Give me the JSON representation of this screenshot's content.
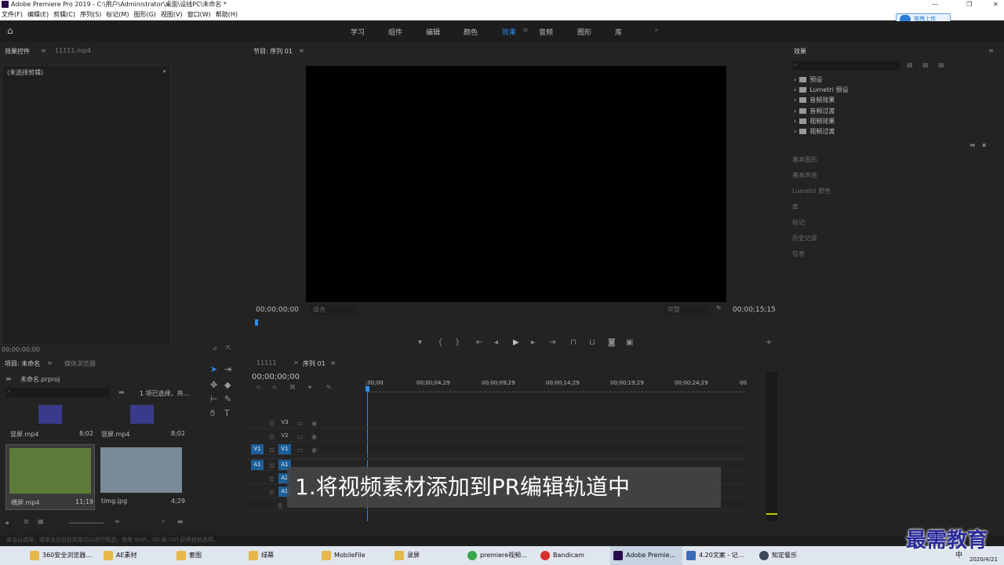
{
  "window": {
    "title": "Adobe Premiere Pro 2019 - C:\\用户\\Administrator\\桌面\\设线PC\\未命名 *"
  },
  "menu": [
    "文件(F)",
    "编辑(E)",
    "剪辑(C)",
    "序列(S)",
    "标记(M)",
    "图形(G)",
    "视图(V)",
    "窗口(W)",
    "帮助(H)"
  ],
  "upload_label": "拖拽上传",
  "workspaces": [
    "学习",
    "组件",
    "编辑",
    "颜色",
    "效果",
    "音频",
    "图形",
    "库"
  ],
  "active_workspace": "效果",
  "source_panel": {
    "tab1": "效果控件",
    "tab2": "11111.mp4",
    "no_clip": "(未选择剪辑)",
    "timecode": "00;00;00;00"
  },
  "program_panel": {
    "title": "节目: 序列 01",
    "timecode_left": "00;00;00;00",
    "fit": "适合",
    "quality": "完整",
    "timecode_right": "00;00;15;15"
  },
  "effects_panel": {
    "title": "效果",
    "tree": [
      "预设",
      "Lumetri 预设",
      "音频效果",
      "音频过渡",
      "视频效果",
      "视频过渡"
    ],
    "sections": [
      "基本图形",
      "基本声音",
      "Lumetri 颜色",
      "库",
      "标记",
      "历史记录",
      "信息"
    ]
  },
  "project_panel": {
    "tab1": "项目: 未命名",
    "tab2": "媒体浏览器",
    "project_file": "未命名.prproj",
    "selection": "1 项已选择，共...",
    "items": [
      {
        "name": "竖屏.mp4",
        "duration": "8;02"
      },
      {
        "name": "竖屏.mp4",
        "duration": "8;02"
      },
      {
        "name": "横屏.mp4",
        "duration": "11;19"
      },
      {
        "name": "timg.jpg",
        "duration": "4;29"
      }
    ]
  },
  "timeline": {
    "tab1": "11111",
    "tab2": "序列 01",
    "timecode": "00;00;00;00",
    "ruler": [
      ";00;00",
      "00;00;04;29",
      "00;00;09;29",
      "00;00;14;29",
      "00;00;19;29",
      "00;00;24;29",
      "00"
    ],
    "tracks": [
      "V3",
      "V2",
      "V1",
      "A1",
      "A2",
      "A3",
      "主"
    ],
    "src_v1": "V1",
    "src_a1": "A1"
  },
  "caption": "1.将视频素材添加到PR编辑轨道中",
  "status_hint": "单击以选择，或单击空白处并拖动以进行框选。使用 Shift、Alt 和 Ctrl 获得其他选项。",
  "taskbar": [
    {
      "label": "360安全浏览器...",
      "color": "#e6b84a"
    },
    {
      "label": "AE素材",
      "color": "#e6b84a"
    },
    {
      "label": "套图",
      "color": "#e6b84a"
    },
    {
      "label": "绿幕",
      "color": "#e6b84a"
    },
    {
      "label": "MobileFile",
      "color": "#e6b84a"
    },
    {
      "label": "录屏",
      "color": "#e6b84a"
    },
    {
      "label": "premiere视频...",
      "color": "#3aa84a"
    },
    {
      "label": "Bandicam",
      "color": "#d8302a"
    },
    {
      "label": "Adobe Premie...",
      "color": "#2a0a4a"
    },
    {
      "label": "4.20文案 - 记...",
      "color": "#3a6ab8"
    },
    {
      "label": "知定餐乐",
      "color": "#3a4a5a"
    }
  ],
  "tray": {
    "ime": "中",
    "date": "2020/4/21"
  },
  "watermark": "最需教育"
}
